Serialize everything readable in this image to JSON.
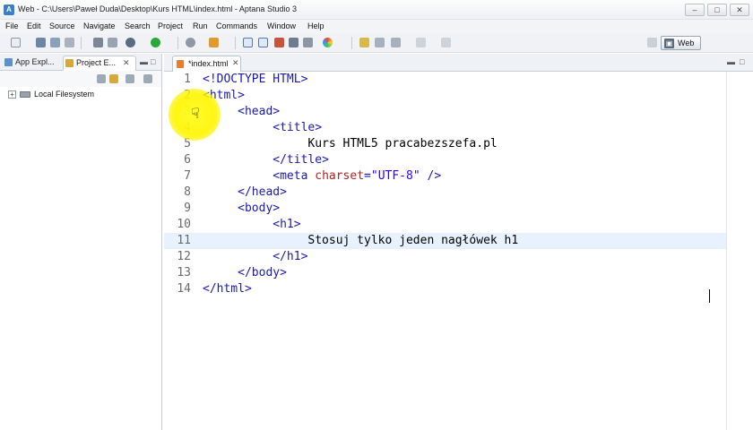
{
  "window": {
    "title": "Web - C:\\Users\\Paweł Duda\\Desktop\\Kurs HTML\\index.html - Aptana Studio 3",
    "app_icon": "aptana-icon",
    "controls": [
      "minimize-icon",
      "maximize-icon",
      "close-icon"
    ]
  },
  "menu": {
    "items": [
      "File",
      "Edit",
      "Source",
      "Navigate",
      "Search",
      "Project",
      "Run",
      "Commands",
      "Window",
      "Help"
    ]
  },
  "toolbar": {
    "perspective_label": "Web"
  },
  "left_panel": {
    "tabs": [
      {
        "label": "App Expl..."
      },
      {
        "label": "Project E..."
      }
    ],
    "tree": [
      {
        "label": "Local Filesystem",
        "icon": "drive-icon",
        "expanded": false
      }
    ]
  },
  "editor": {
    "tab_label": "*index.html",
    "current_line": 11,
    "lines": [
      {
        "num": "1",
        "parts": [
          {
            "t": "<!DOCTYPE HTML>",
            "c": "tg"
          }
        ]
      },
      {
        "num": "2",
        "parts": [
          {
            "t": "<html>",
            "c": "tg"
          }
        ]
      },
      {
        "num": "3",
        "parts": [
          {
            "t": "     ",
            "c": ""
          },
          {
            "t": "<head>",
            "c": "tg"
          }
        ]
      },
      {
        "num": "4",
        "parts": [
          {
            "t": "          ",
            "c": ""
          },
          {
            "t": "<title>",
            "c": "tg"
          }
        ]
      },
      {
        "num": "5",
        "parts": [
          {
            "t": "               Kurs HTML5 pracabezszefa.pl",
            "c": ""
          }
        ]
      },
      {
        "num": "6",
        "parts": [
          {
            "t": "          ",
            "c": ""
          },
          {
            "t": "</title>",
            "c": "tg"
          }
        ]
      },
      {
        "num": "7",
        "parts": [
          {
            "t": "          ",
            "c": ""
          },
          {
            "t": "<meta ",
            "c": "tg"
          },
          {
            "t": "charset",
            "c": "at"
          },
          {
            "t": "=",
            "c": "tg"
          },
          {
            "t": "\"UTF-8\"",
            "c": "av"
          },
          {
            "t": " />",
            "c": "tg"
          }
        ]
      },
      {
        "num": "8",
        "parts": [
          {
            "t": "     ",
            "c": ""
          },
          {
            "t": "</head>",
            "c": "tg"
          }
        ]
      },
      {
        "num": "9",
        "parts": [
          {
            "t": "     ",
            "c": ""
          },
          {
            "t": "<body>",
            "c": "tg"
          }
        ]
      },
      {
        "num": "10",
        "parts": [
          {
            "t": "          ",
            "c": ""
          },
          {
            "t": "<h1>",
            "c": "tg"
          }
        ]
      },
      {
        "num": "11",
        "parts": [
          {
            "t": "               Stosuj tylko jeden nagłówek h1",
            "c": ""
          }
        ]
      },
      {
        "num": "12",
        "parts": [
          {
            "t": "          ",
            "c": ""
          },
          {
            "t": "</h1>",
            "c": "tg"
          }
        ]
      },
      {
        "num": "13",
        "parts": [
          {
            "t": "     ",
            "c": ""
          },
          {
            "t": "</body>",
            "c": "tg"
          }
        ]
      },
      {
        "num": "14",
        "parts": [
          {
            "t": "</html>",
            "c": "tg"
          }
        ]
      }
    ]
  },
  "colors": {
    "tag": "#1a1aa6",
    "attribute": "#b22222",
    "attribute_value": "#2a00ff",
    "current_line_bg": "#e8f2fe",
    "cursor_highlight": "#fff200"
  }
}
